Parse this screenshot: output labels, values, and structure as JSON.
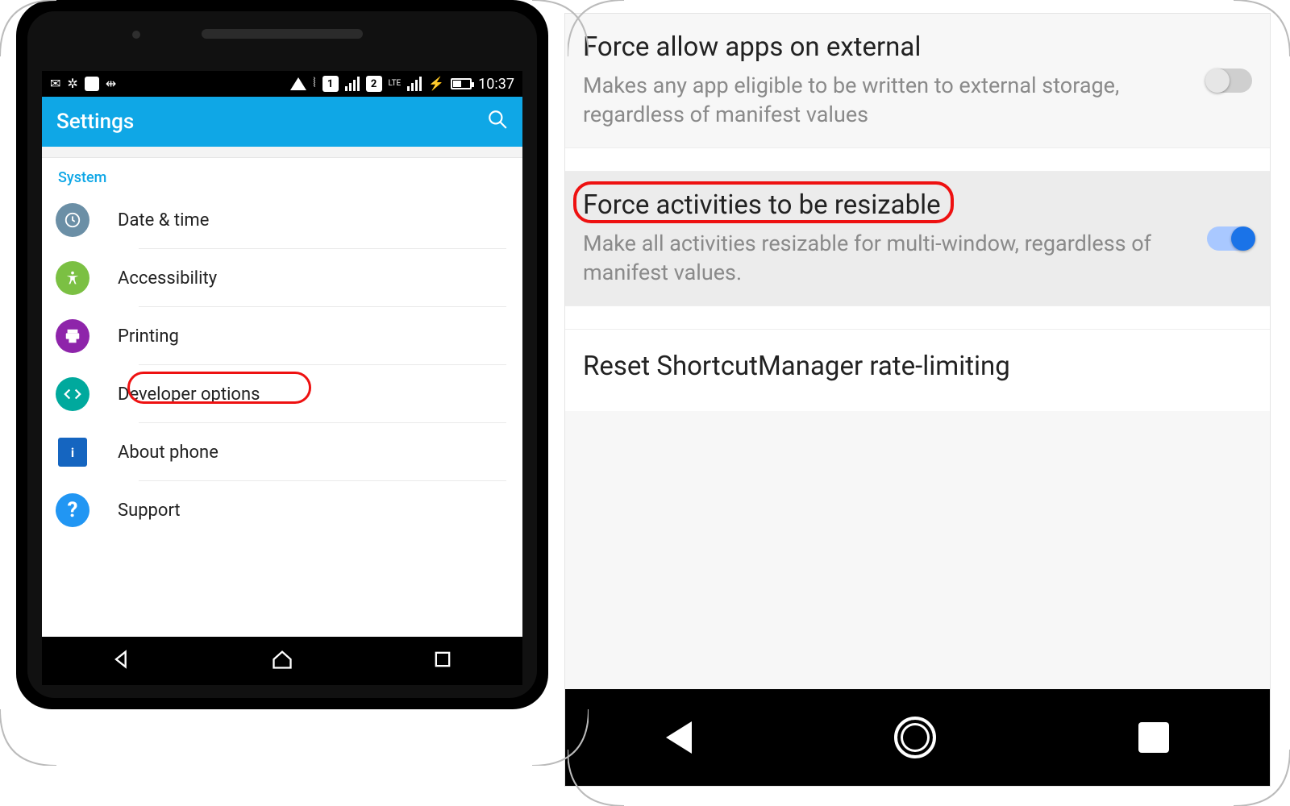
{
  "left": {
    "statusbar": {
      "time": "10:37",
      "lte_label": "LTE",
      "sim1": "1",
      "sim2": "2"
    },
    "appbar_title": "Settings",
    "section_label": "System",
    "items": [
      {
        "icon": "clock-icon",
        "label": "Date & time"
      },
      {
        "icon": "accessibility-icon",
        "label": "Accessibility"
      },
      {
        "icon": "printer-icon",
        "label": "Printing"
      },
      {
        "icon": "developer-icon",
        "label": "Developer options",
        "highlighted": true
      },
      {
        "icon": "info-icon",
        "label": "About phone"
      },
      {
        "icon": "help-icon",
        "label": "Support"
      }
    ]
  },
  "right": {
    "items": [
      {
        "title": "Force allow apps on external",
        "sub": "Makes any app eligible to be written to external storage, regardless of manifest values",
        "toggle": "off"
      },
      {
        "title": "Force activities to be resizable",
        "sub": "Make all activities resizable for multi-window, regardless of manifest values.",
        "toggle": "on",
        "highlighted": true
      },
      {
        "title": "Reset ShortcutManager rate-limiting",
        "sub": "",
        "toggle": null
      }
    ]
  }
}
